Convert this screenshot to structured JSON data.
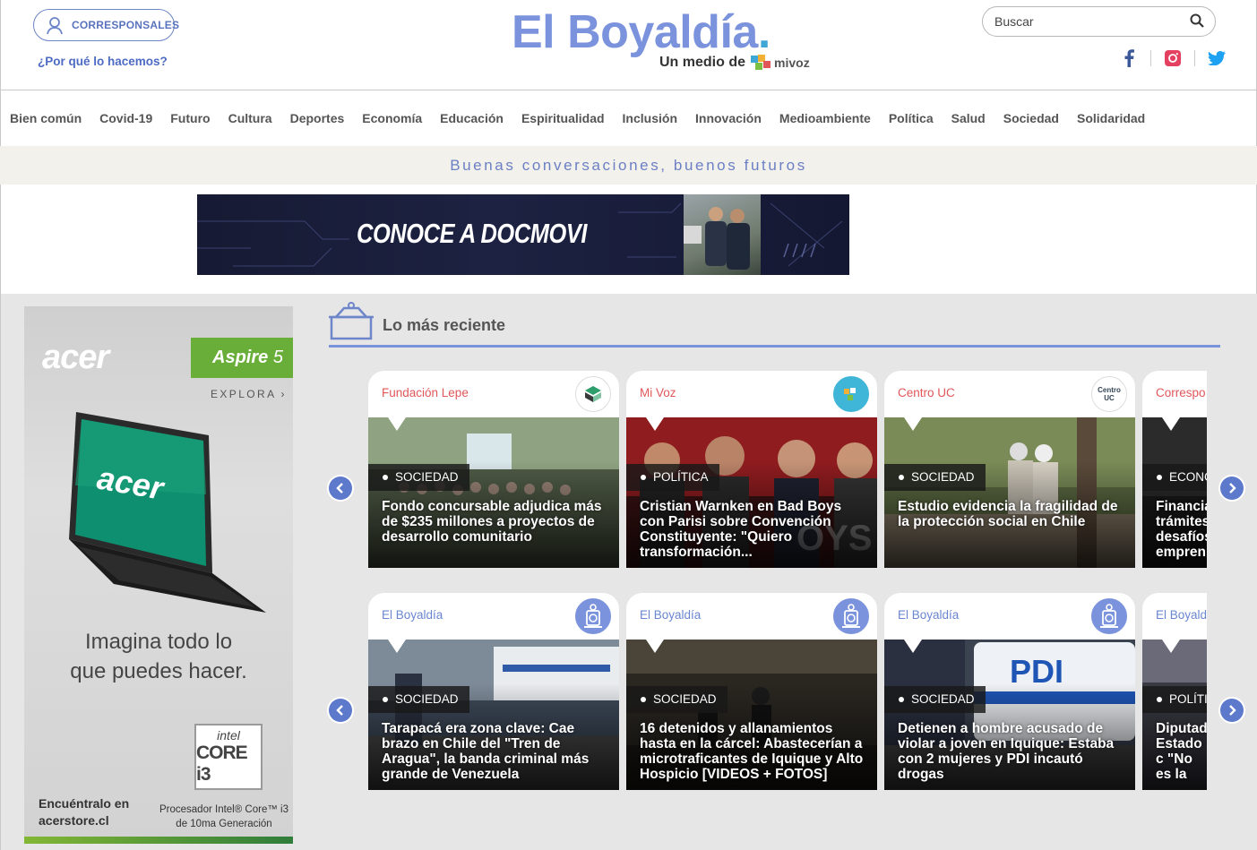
{
  "header": {
    "corresponsales_label": "CORRESPONSALES",
    "why_link": "¿Por qué lo hacemos?",
    "logo_text": "El Boyaldía",
    "logo_dot": ".",
    "medio_label": "Un medio de",
    "mivoz_label": "mivoz",
    "search_placeholder": "Buscar",
    "social": [
      "facebook-icon",
      "instagram-icon",
      "twitter-icon"
    ]
  },
  "nav": [
    "Bien común",
    "Covid-19",
    "Futuro",
    "Cultura",
    "Deportes",
    "Economía",
    "Educación",
    "Espiritualidad",
    "Inclusión",
    "Innovación",
    "Medioambiente",
    "Política",
    "Salud",
    "Sociedad",
    "Solidaridad"
  ],
  "band_text": "Buenas conversaciones, buenos futuros",
  "banner": {
    "text": "CONOCE A DOCMOVI"
  },
  "ad": {
    "brand": "acer",
    "model_prefix": "Aspire",
    "model_number": "5",
    "explora": "EXPLORA ›",
    "screen_brand": "acer",
    "headline_1": "Imagina todo lo",
    "headline_2": "que puedes hacer.",
    "intel_1": "intel",
    "intel_2": "CORE i3",
    "find_1": "Encuéntralo en",
    "find_2": "acerstore.cl",
    "proc_1": "Procesador Intel® Core™ i3",
    "proc_2": "de 10ma Generación"
  },
  "recent": {
    "title": "Lo más reciente",
    "row1": [
      {
        "source": "Fundación Lepe",
        "category": "SOCIEDAD",
        "title": "Fondo concursable adjudica más de $235 millones a proyectos de desarrollo comunitario"
      },
      {
        "source": "Mi Voz",
        "category": "POLÍTICA",
        "title": "Cristian Warnken en Bad Boys con Parisi sobre Convención Constituyente: \"Quiero transformación..."
      },
      {
        "source": "Centro UC",
        "category": "SOCIEDAD",
        "title": "Estudio evidencia la fragilidad de la protección social en Chile"
      },
      {
        "source": "Correspo",
        "category": "ECONC",
        "title": "Financia trámites desafíos empren"
      }
    ],
    "row2": [
      {
        "source": "El Boyaldía",
        "category": "SOCIEDAD",
        "title": "Tarapacá era zona clave: Cae brazo en Chile del \"Tren de Aragua\", la banda criminal más grande de Venezuela"
      },
      {
        "source": "El Boyaldía",
        "category": "SOCIEDAD",
        "title": "16 detenidos y allanamientos hasta en la cárcel: Abastecerían a microtraficantes de Iquique y Alto Hospicio [VIDEOS + FOTOS]"
      },
      {
        "source": "El Boyaldía",
        "category": "SOCIEDAD",
        "title": "Detienen a hombre acusado de violar a joven en Iquique: Estaba con 2 mujeres y PDI incautó drogas"
      },
      {
        "source": "El Boyald",
        "category": "POLÍTI",
        "title": "Diputad Estado c \"No es la"
      }
    ],
    "logo_centro_uc": "Centro UC"
  },
  "colors": {
    "accent": "#5c79cc",
    "logo": "#7b92dc",
    "source_red": "#e0575a",
    "source_blue": "#6b86d0"
  }
}
